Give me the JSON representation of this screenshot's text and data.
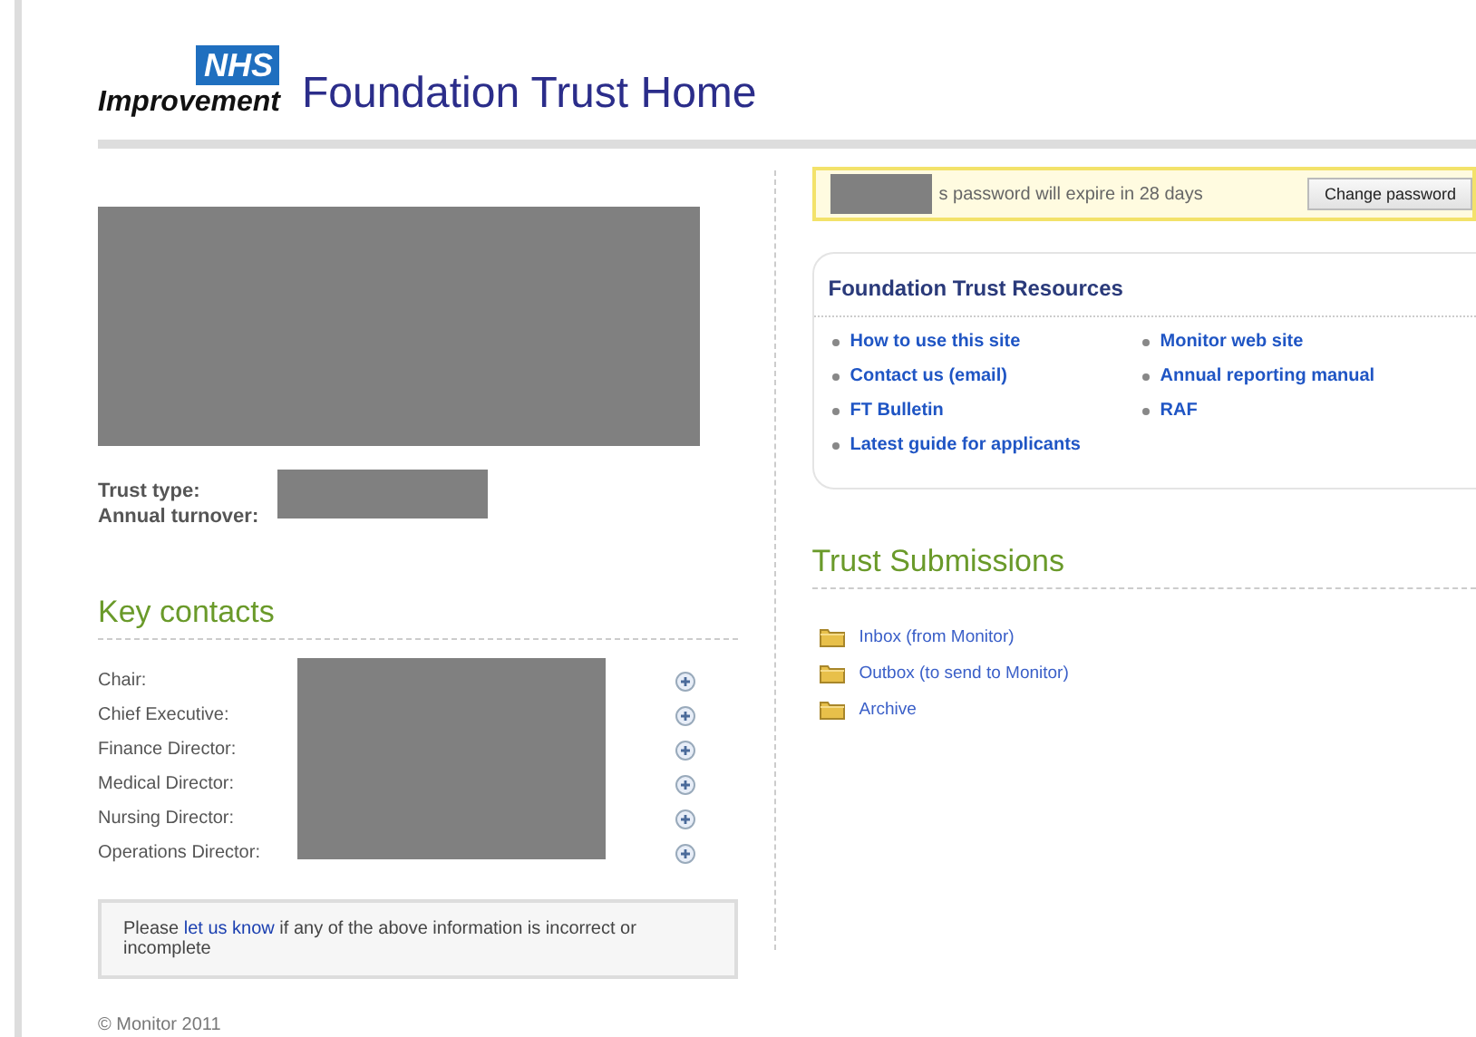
{
  "header": {
    "logo_badge": "NHS",
    "logo_text": "Improvement",
    "title": "Foundation Trust Home"
  },
  "trust": {
    "fields": [
      {
        "label": "Trust type:"
      },
      {
        "label": "Annual turnover:"
      }
    ]
  },
  "key_contacts": {
    "title": "Key contacts",
    "contacts": [
      {
        "role": "Chair:"
      },
      {
        "role": "Chief Executive:"
      },
      {
        "role": "Finance Director:"
      },
      {
        "role": "Medical Director:"
      },
      {
        "role": "Nursing Director:"
      },
      {
        "role": "Operations Director:"
      }
    ]
  },
  "notice": {
    "before": "Please ",
    "link": "let us know",
    "after": " if any of the above information is incorrect or incomplete"
  },
  "footer": "© Monitor 2011",
  "password_notice": {
    "text": "s password will expire in 28 days",
    "button": "Change password"
  },
  "resources": {
    "title": "Foundation Trust Resources",
    "columns": [
      [
        "How to use this site",
        "Contact us (email)",
        "FT Bulletin",
        "Latest guide for applicants"
      ],
      [
        "Monitor web site",
        "Annual reporting manual",
        "RAF"
      ]
    ]
  },
  "submissions": {
    "title": "Trust Submissions",
    "folders": [
      "Inbox (from Monitor)",
      "Outbox (to send to Monitor)",
      "Archive"
    ]
  }
}
